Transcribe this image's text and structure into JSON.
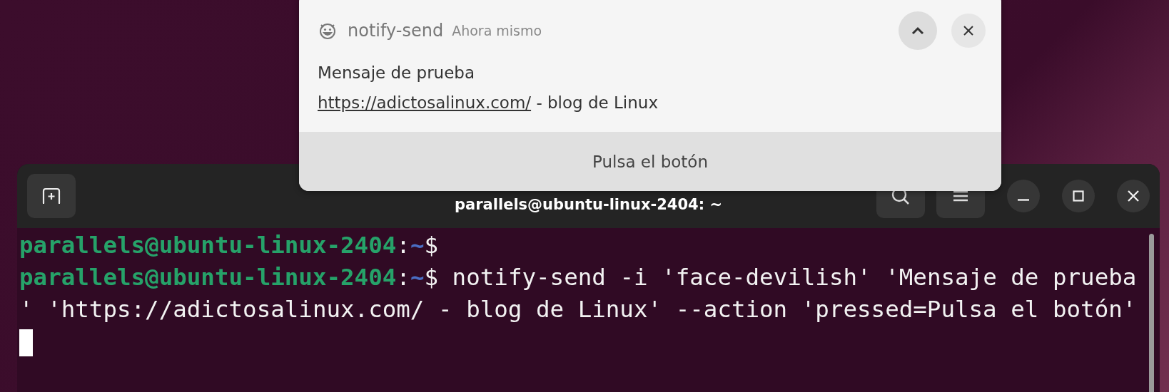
{
  "terminal": {
    "title": "parallels@ubuntu-linux-2404: ~",
    "lines": [
      {
        "kind": "prompt",
        "user_host": "parallels@ubuntu-linux-2404",
        "sep": ":",
        "path": "~",
        "sign": "$"
      },
      {
        "kind": "prompt",
        "user_host": "parallels@ubuntu-linux-2404",
        "sep": ":",
        "path": "~",
        "sign": "$",
        "command": "notify-send -i 'face-devilish' 'Mensaje de prueba"
      },
      {
        "kind": "wrap",
        "text": "' 'https://adictosalinux.com/ - blog de Linux' --action 'pressed=Pulsa el botón'"
      }
    ]
  },
  "notification": {
    "app": "notify-send",
    "time": "Ahora mismo",
    "summary": "Mensaje de prueba",
    "link": "https://adictosalinux.com/",
    "body": " - blog de Linux",
    "action": "Pulsa el botón"
  }
}
